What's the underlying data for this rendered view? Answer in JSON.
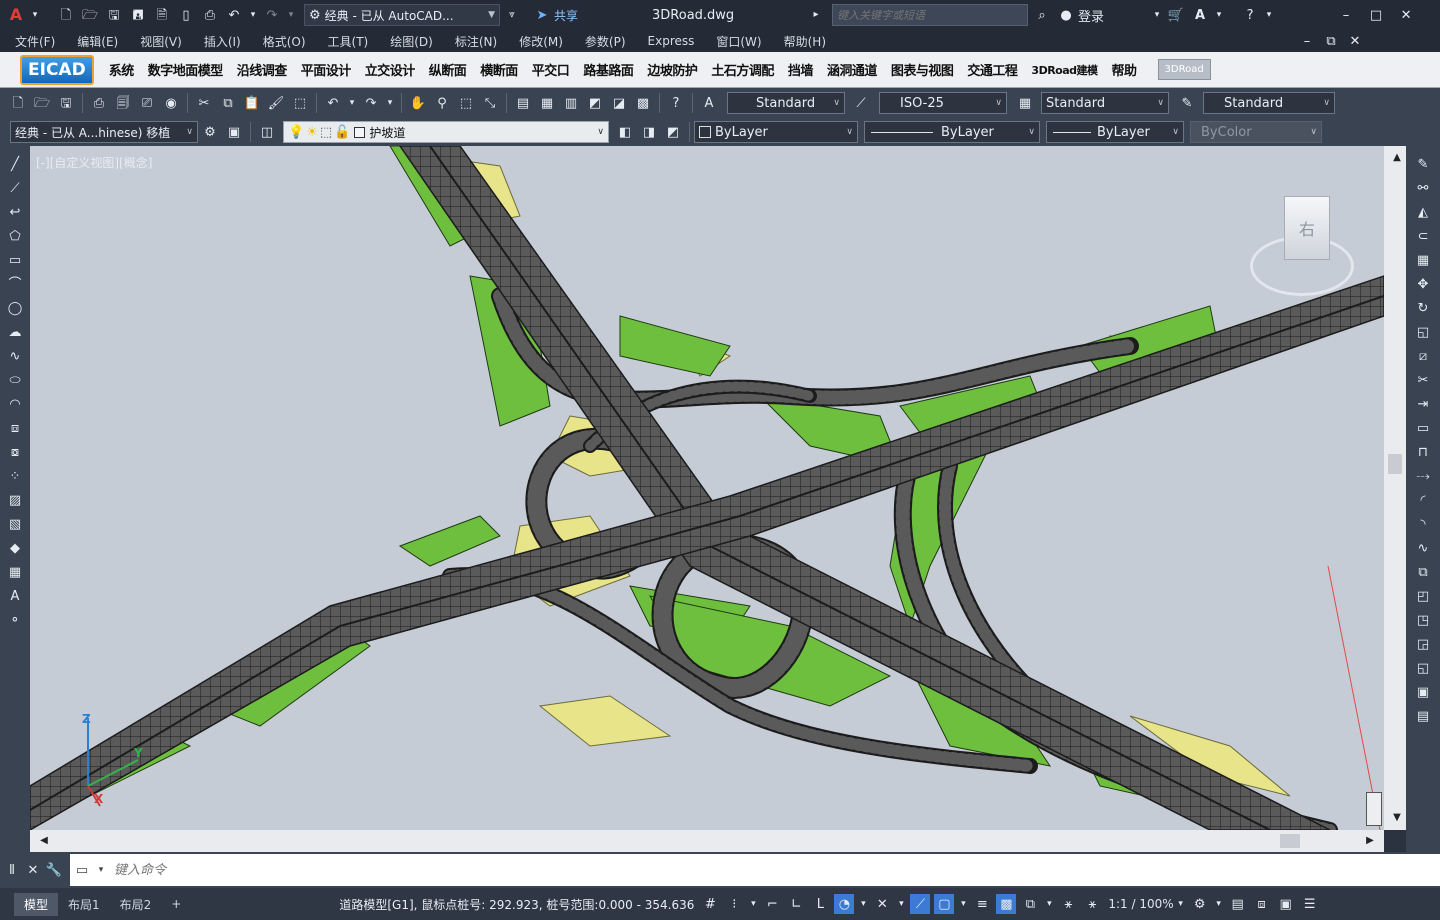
{
  "title": {
    "workspace": "经典 - 已从 AutoCAD...",
    "share": "共享",
    "filename": "3DRoad.dwg",
    "search_placeholder": "键入关键字或短语",
    "login": "登录"
  },
  "menu": [
    "文件(F)",
    "编辑(E)",
    "视图(V)",
    "插入(I)",
    "格式(O)",
    "工具(T)",
    "绘图(D)",
    "标注(N)",
    "修改(M)",
    "参数(P)",
    "Express",
    "窗口(W)",
    "帮助(H)"
  ],
  "ribbon": {
    "logo": "EICAD",
    "items": [
      "系统",
      "数字地面模型",
      "沿线调查",
      "平面设计",
      "立交设计",
      "纵断面",
      "横断面",
      "平交口",
      "路基路面",
      "边坡防护",
      "土石方调配",
      "挡墙",
      "涵洞通道",
      "图表与视图",
      "交通工程",
      "3DRoad建模",
      "帮助"
    ],
    "tab3d": "3DRoad"
  },
  "styles": {
    "text_style": "Standard",
    "dim_style": "ISO-25",
    "table_style": "Standard",
    "mleader_style": "Standard"
  },
  "layer": {
    "workspace": "经典 - 已从 A...hinese) 移植",
    "current_layer": "护坡道",
    "color": "ByLayer",
    "linetype": "ByLayer",
    "lineweight": "ByLayer",
    "plotstyle": "ByColor"
  },
  "viewport": {
    "label": "[-][自定义视图][概念]",
    "viewcube_face": "右",
    "axis_z": "Z",
    "axis_y": "Y",
    "axis_x": "X"
  },
  "command": {
    "placeholder": "键入命令"
  },
  "tabs": [
    "模型",
    "布局1",
    "布局2",
    "+"
  ],
  "status": {
    "text": "道路模型[G1], 鼠标点桩号: 292.923, 桩号范围:0.000 - 354.636",
    "scale": "1:1 / 100%"
  },
  "colors": {
    "road": "#4a4a4a",
    "slope": "#6fbf3f",
    "fill": "#e8e48a",
    "viewport_bg": "#c5ccd6"
  }
}
